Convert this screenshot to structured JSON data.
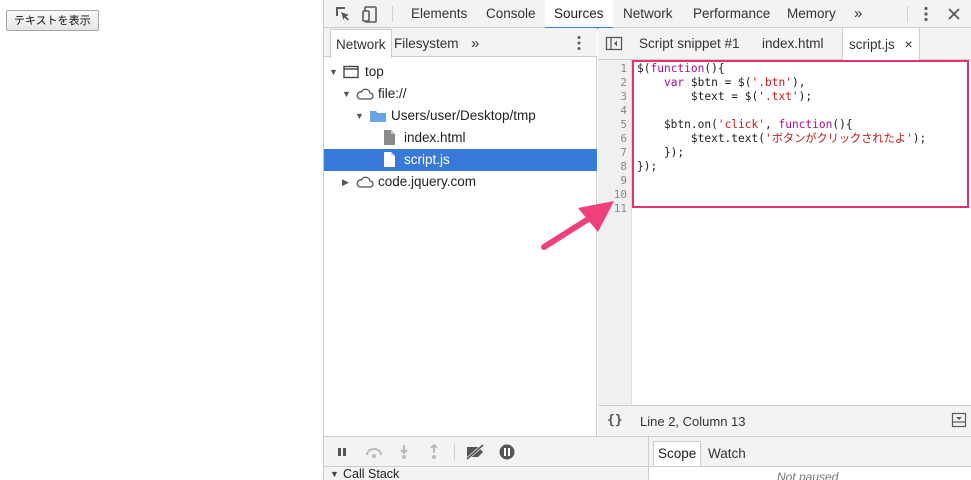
{
  "page": {
    "button_label": "テキストを表示"
  },
  "toolbar": {
    "tabs": [
      "Elements",
      "Console",
      "Sources",
      "Network",
      "Performance",
      "Memory"
    ],
    "overflow": "»"
  },
  "navigator": {
    "tabs": [
      "Network",
      "Filesystem"
    ],
    "overflow": "»",
    "tree": [
      {
        "label": "top"
      },
      {
        "label": "file://"
      },
      {
        "label": "Users/user/Desktop/tmp"
      },
      {
        "label": "index.html"
      },
      {
        "label": "script.js"
      },
      {
        "label": "code.jquery.com"
      }
    ]
  },
  "editor": {
    "tabs": [
      "Script snippet #1",
      "index.html",
      "script.js"
    ],
    "close_glyph": "×",
    "line_numbers": [
      "1",
      "2",
      "3",
      "4",
      "5",
      "6",
      "7",
      "8",
      "9",
      "10",
      "11"
    ],
    "lines": [
      "$(function(){",
      "    var $btn = $('.btn'),",
      "        $text = $('.txt');",
      "",
      "    $btn.on('click', function(){",
      "        $text.text('ボタンがクリックされたよ');",
      "    });",
      "});",
      "",
      "",
      ""
    ],
    "status": "Line 2, Column 13",
    "pretty_print": "{}"
  },
  "debugger": {
    "scope_tabs": [
      "Scope",
      "Watch"
    ],
    "call_stack_label": "Call Stack",
    "not_paused": "Not paused"
  },
  "colors": {
    "accent": "#3879d9",
    "highlight": "#e8326e"
  }
}
